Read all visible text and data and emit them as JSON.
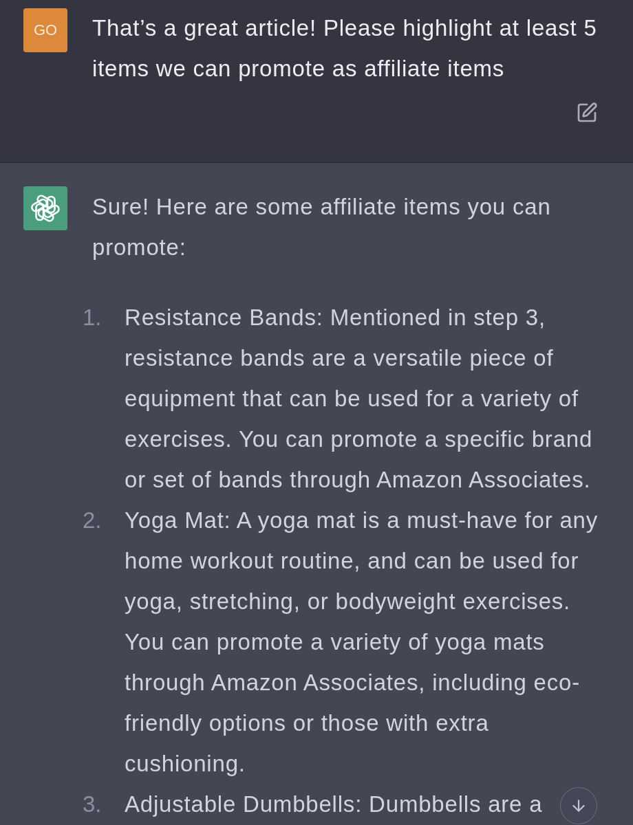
{
  "messages": [
    {
      "kind": "user",
      "avatar": "GO",
      "text": "That’s a great article! Please highlight at least 5 items we can promote as affiliate items"
    },
    {
      "kind": "assistant",
      "text": "Sure! Here are some affiliate items you can promote:",
      "list": [
        {
          "number": "1.",
          "text": "Resistance Bands: Mentioned in step 3, resistance bands are a versatile piece of equipment that can be used for a variety of exercises. You can promote a specific brand or set of bands through Amazon Associates."
        },
        {
          "number": "2.",
          "text": "Yoga Mat: A yoga mat is a must-have for any home workout routine, and can be used for yoga, stretching, or bodyweight exercises. You can promote a variety of yoga mats through Amazon Associates, including eco-friendly options or those with extra cushioning."
        },
        {
          "number": "3.",
          "text": "Adjustable Dumbbells: Dumbbells are a"
        }
      ]
    }
  ]
}
